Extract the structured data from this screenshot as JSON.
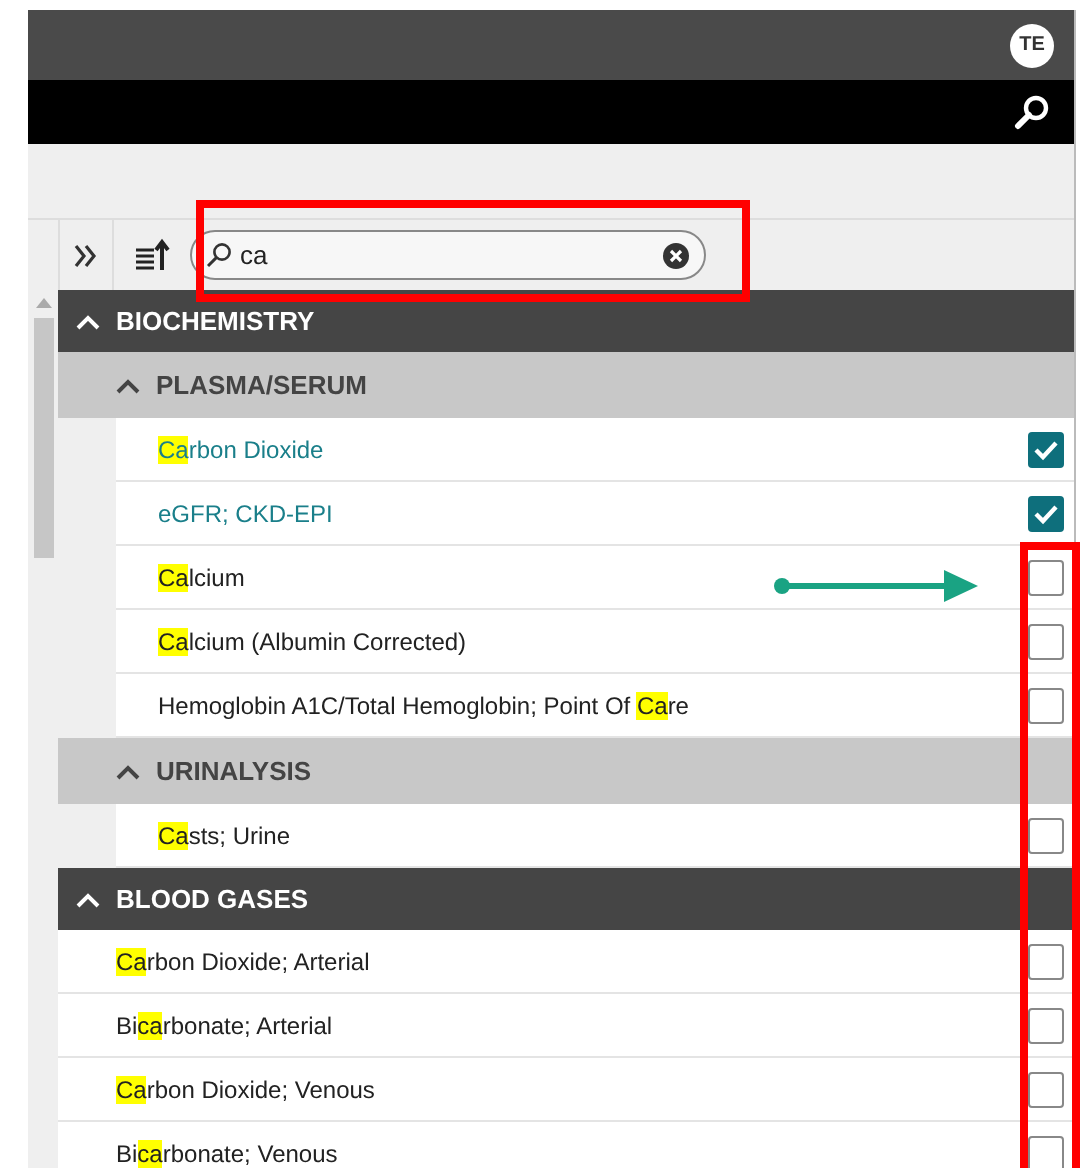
{
  "header": {
    "avatar": "TE"
  },
  "search": {
    "value": "ca"
  },
  "groups": [
    {
      "title": "BIOCHEMISTRY",
      "expanded": true,
      "children": [
        {
          "kind": "subgroup",
          "title": "PLASMA/SERUM",
          "expanded": true,
          "children": [
            {
              "kind": "item",
              "checked": true,
              "segments": [
                {
                  "text": "Ca",
                  "match": true
                },
                {
                  "text": "rbon Dioxide",
                  "match": false
                }
              ]
            },
            {
              "kind": "item",
              "checked": true,
              "segments": [
                {
                  "text": "eGFR; CKD-EPI",
                  "match": false
                }
              ]
            },
            {
              "kind": "item",
              "checked": false,
              "segments": [
                {
                  "text": "Ca",
                  "match": true
                },
                {
                  "text": "lcium",
                  "match": false
                }
              ]
            },
            {
              "kind": "item",
              "checked": false,
              "segments": [
                {
                  "text": "Ca",
                  "match": true
                },
                {
                  "text": "lcium (Albumin Corrected)",
                  "match": false
                }
              ]
            },
            {
              "kind": "item",
              "checked": false,
              "segments": [
                {
                  "text": "Hemoglobin A1C/Total Hemoglobin; Point Of ",
                  "match": false
                },
                {
                  "text": "Ca",
                  "match": true
                },
                {
                  "text": "re",
                  "match": false
                }
              ]
            }
          ]
        },
        {
          "kind": "subgroup",
          "title": "URINALYSIS",
          "expanded": true,
          "children": [
            {
              "kind": "item",
              "checked": false,
              "segments": [
                {
                  "text": "Ca",
                  "match": true
                },
                {
                  "text": "sts; Urine",
                  "match": false
                }
              ]
            }
          ]
        }
      ]
    },
    {
      "title": "BLOOD GASES",
      "expanded": true,
      "children": [
        {
          "kind": "item",
          "checked": false,
          "segments": [
            {
              "text": "Ca",
              "match": true
            },
            {
              "text": "rbon Dioxide; Arterial",
              "match": false
            }
          ]
        },
        {
          "kind": "item",
          "checked": false,
          "segments": [
            {
              "text": "Bi",
              "match": false
            },
            {
              "text": "ca",
              "match": true
            },
            {
              "text": "rbonate; Arterial",
              "match": false
            }
          ]
        },
        {
          "kind": "item",
          "checked": false,
          "segments": [
            {
              "text": "Ca",
              "match": true
            },
            {
              "text": "rbon Dioxide; Venous",
              "match": false
            }
          ]
        },
        {
          "kind": "item",
          "checked": false,
          "segments": [
            {
              "text": "Bi",
              "match": false
            },
            {
              "text": "ca",
              "match": true
            },
            {
              "text": "rbonate; Venous",
              "match": false
            }
          ]
        }
      ]
    }
  ]
}
